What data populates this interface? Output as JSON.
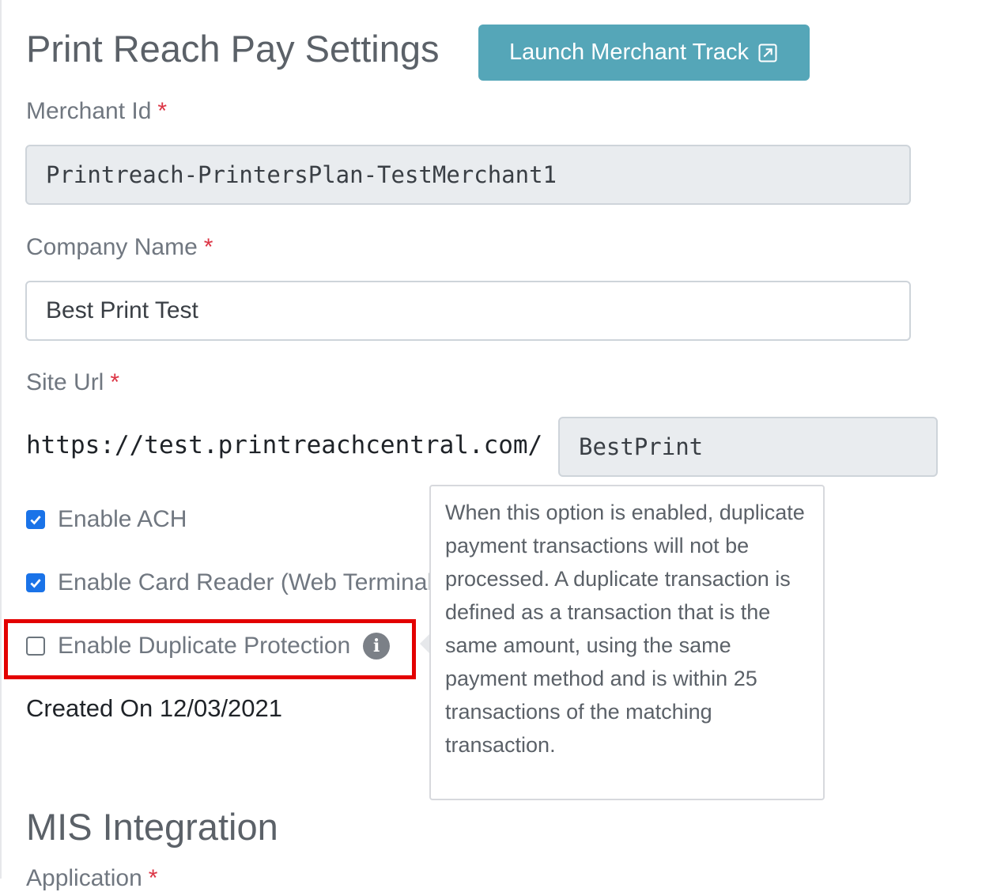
{
  "page": {
    "title": "Print Reach Pay Settings",
    "launch_button": {
      "label": "Launch Merchant Track",
      "icon": "external-link-icon"
    }
  },
  "colors": {
    "accent": "#55a6b8",
    "required": "#dc3545",
    "highlight": "#e30000",
    "checkbox": "#1a73e8"
  },
  "fields": {
    "merchant_id": {
      "label": "Merchant Id",
      "required_mark": "*",
      "value": "Printreach-PrintersPlan-TestMerchant1"
    },
    "company_name": {
      "label": "Company Name",
      "required_mark": "*",
      "value": "Best Print Test"
    },
    "site_url": {
      "label": "Site Url",
      "required_mark": "*",
      "prefix": "https://test.printreachcentral.com/",
      "value": "BestPrint"
    }
  },
  "options": {
    "enable_ach": {
      "label": "Enable ACH",
      "checked": true
    },
    "enable_card_reader": {
      "label": "Enable Card Reader (Web Terminal)",
      "checked": true
    },
    "enable_duplicate_protection": {
      "label": "Enable Duplicate Protection",
      "checked": false,
      "info_icon": "info-icon"
    }
  },
  "tooltip": {
    "text": "When this option is enabled, duplicate payment transactions will not be processed. A duplicate transaction is defined as a transaction that is the same amount, using the same payment method and is within 25 transactions of the matching transaction."
  },
  "created_on": "Created On 12/03/2021",
  "mis": {
    "title": "MIS Integration",
    "application_label": "Application",
    "required_mark": "*"
  }
}
